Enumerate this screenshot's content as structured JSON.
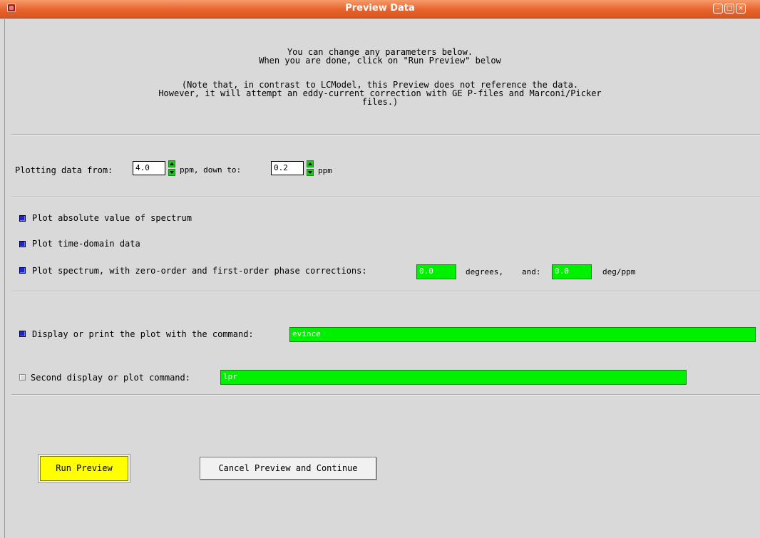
{
  "window": {
    "title": "Preview Data",
    "controls": {
      "minimize": "–",
      "maximize": "□",
      "close": "×"
    }
  },
  "instructions": {
    "text1": "You can change any parameters below.\nWhen you are done, click on \"Run Preview\" below",
    "text2": "(Note that, in contrast to LCModel, this Preview does not reference the data.\nHowever, it will attempt an eddy-current correction with GE P-files and Marconi/Picker\nfiles.)"
  },
  "range": {
    "from_label": "Plotting data from:",
    "from_value": "4.0",
    "from_unit": "ppm, down to:",
    "to_value": "0.2",
    "to_unit": "ppm"
  },
  "options": {
    "abs_label": "Plot absolute value of spectrum",
    "abs_checked": true,
    "time_label": "Plot time-domain data",
    "time_checked": true,
    "phase_label": "Plot spectrum, with zero-order and first-order phase corrections:",
    "phase_checked": true,
    "phase0_value": "0.0",
    "phase0_unit": "degrees,",
    "and_label": "and:",
    "phase1_value": "0.0",
    "phase1_unit": "deg/ppm"
  },
  "display": {
    "cmd1_label": "Display or print the plot with the command:",
    "cmd1_checked": true,
    "cmd1_value": "evince",
    "cmd2_label": "Second display or plot command:",
    "cmd2_checked": false,
    "cmd2_value": "lpr"
  },
  "buttons": {
    "run": "Run Preview",
    "cancel": "Cancel Preview and Continue"
  },
  "colors": {
    "titlebar": "#e8622c",
    "field_green": "#00f100",
    "run_yellow": "#ffff00",
    "checkbox_blue": "#1a25d4"
  }
}
